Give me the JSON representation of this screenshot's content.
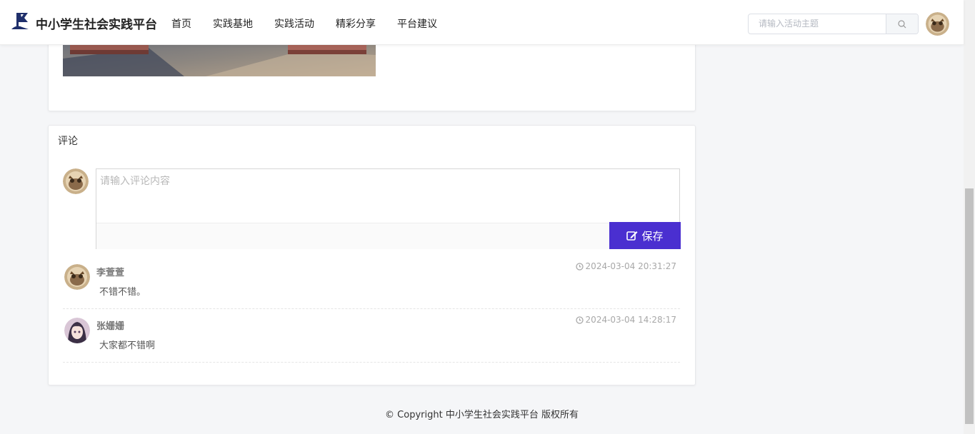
{
  "header": {
    "brand": "中小学生社会实践平台",
    "nav": [
      "首页",
      "实践基地",
      "实践活动",
      "精彩分享",
      "平台建议"
    ],
    "search_placeholder": "请输入活动主题",
    "logo_icon": "flag-logo-icon",
    "search_icon": "search-icon"
  },
  "comments_section": {
    "title": "评论",
    "input_placeholder": "请输入评论内容",
    "save_label": "保存",
    "save_icon": "edit-icon",
    "items": [
      {
        "name": "李萱萱",
        "text": "不错不错。",
        "time": "2024-03-04 20:31:27"
      },
      {
        "name": "张姗姗",
        "text": "大家都不错啊",
        "time": "2024-03-04 14:28:17"
      }
    ]
  },
  "footer": {
    "text": "© Copyright 中小学生社会实践平台 版权所有"
  },
  "colors": {
    "accent": "#4a2fd0",
    "brand_navy": "#1f2f6b"
  }
}
